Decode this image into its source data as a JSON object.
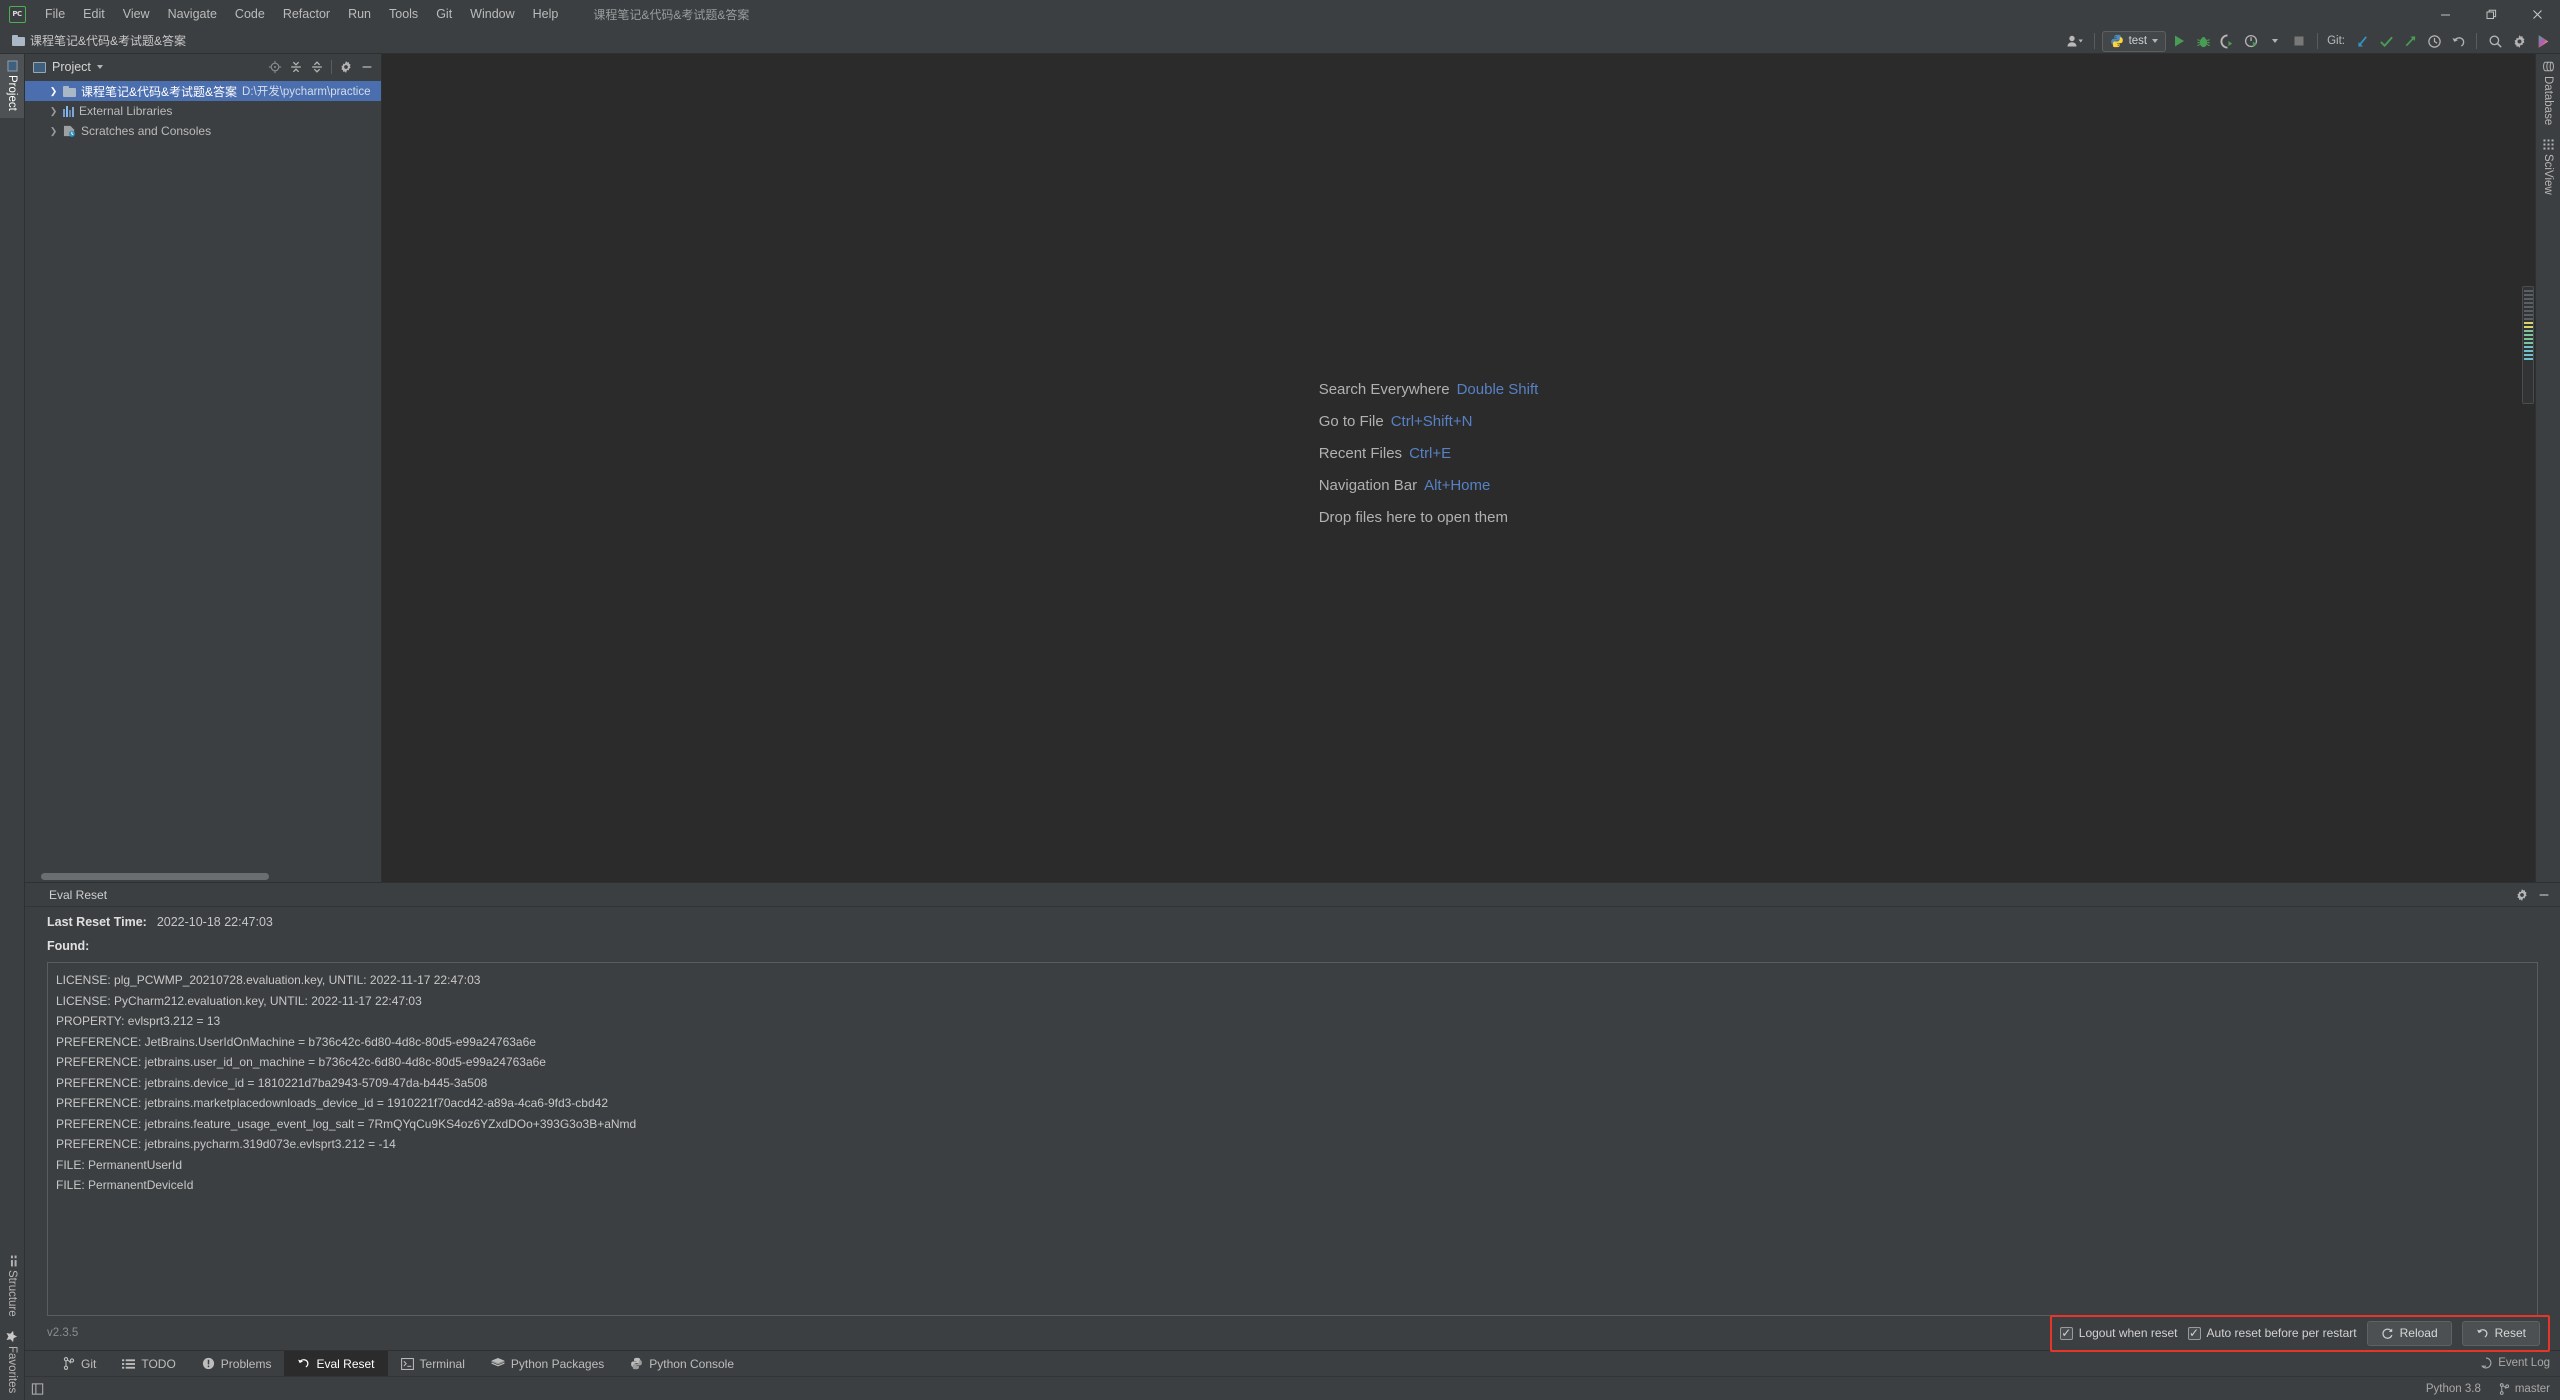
{
  "window": {
    "title": "课程笔记&代码&考试题&答案",
    "controls": {
      "minimize": "minimize-icon",
      "maximize": "maximize-icon",
      "close": "close-icon"
    }
  },
  "menubar": {
    "items": [
      "File",
      "Edit",
      "View",
      "Navigate",
      "Code",
      "Refactor",
      "Run",
      "Tools",
      "Git",
      "Window",
      "Help"
    ]
  },
  "navbar": {
    "breadcrumb": "课程笔记&代码&考试题&答案"
  },
  "toolbar": {
    "run_config": "test",
    "git_label": "Git:",
    "icons": [
      "user-avatar-icon",
      "run-icon",
      "debug-icon",
      "run-coverage-icon",
      "profile-icon",
      "stop-icon",
      "update-project-icon",
      "commit-icon",
      "push-icon",
      "history-icon",
      "rollback-icon",
      "search-everywhere-icon",
      "settings-icon",
      "ide-feature-icon"
    ]
  },
  "left_rail": {
    "top": [
      {
        "label": "Project",
        "active": true,
        "icon": "project-icon"
      }
    ],
    "bottom": [
      {
        "label": "Structure",
        "active": false,
        "icon": "structure-icon"
      },
      {
        "label": "Favorites",
        "active": false,
        "icon": "star-icon"
      }
    ]
  },
  "right_rail": {
    "items": [
      {
        "label": "Database",
        "icon": "database-icon"
      },
      {
        "label": "SciView",
        "icon": "sciview-icon"
      }
    ]
  },
  "project": {
    "title": "Project",
    "tools": [
      "locate-icon",
      "expand-all-icon",
      "collapse-all-icon",
      "gear-icon",
      "hide-icon"
    ],
    "tree": [
      {
        "label": "课程笔记&代码&考试题&答案",
        "path": "D:\\开发\\pycharm\\practice",
        "icon": "folder-icon",
        "selected": true
      },
      {
        "label": "External Libraries",
        "path": "",
        "icon": "library-icon",
        "selected": false
      },
      {
        "label": "Scratches and Consoles",
        "path": "",
        "icon": "scratches-icon",
        "selected": false
      }
    ]
  },
  "editor": {
    "hints": [
      {
        "label": "Search Everywhere",
        "shortcut": "Double Shift"
      },
      {
        "label": "Go to File",
        "shortcut": "Ctrl+Shift+N"
      },
      {
        "label": "Recent Files",
        "shortcut": "Ctrl+E"
      },
      {
        "label": "Navigation Bar",
        "shortcut": "Alt+Home"
      }
    ],
    "drop_hint": "Drop files here to open them"
  },
  "eval_reset": {
    "panel_title": "Eval Reset",
    "panel_tools": [
      "gear-icon",
      "hide-icon"
    ],
    "last_reset_label": "Last Reset Time:",
    "last_reset_value": "2022-10-18 22:47:03",
    "found_label": "Found:",
    "log_lines": [
      "LICENSE: plg_PCWMP_20210728.evaluation.key, UNTIL: 2022-11-17 22:47:03",
      "LICENSE: PyCharm212.evaluation.key, UNTIL: 2022-11-17 22:47:03",
      "PROPERTY: evlsprt3.212 = 13",
      "PREFERENCE: JetBrains.UserIdOnMachine = b736c42c-6d80-4d8c-80d5-e99a24763a6e",
      "PREFERENCE: jetbrains.user_id_on_machine = b736c42c-6d80-4d8c-80d5-e99a24763a6e",
      "PREFERENCE: jetbrains.device_id = 1810221d7ba2943-5709-47da-b445-3a508",
      "PREFERENCE: jetbrains.marketplacedownloads_device_id = 1910221f70acd42-a89a-4ca6-9fd3-cbd42",
      "PREFERENCE: jetbrains.feature_usage_event_log_salt = 7RmQYqCu9KS4oz6YZxdDOo+393G3o3B+aNmd",
      "PREFERENCE: jetbrains.pycharm.319d073e.evlsprt3.212 = -14",
      "FILE: PermanentUserId",
      "FILE: PermanentDeviceId"
    ],
    "version": "v2.3.5",
    "checkbox_logout": "Logout when reset",
    "checkbox_logout_checked": "✓",
    "checkbox_auto": "Auto reset before per restart",
    "checkbox_auto_checked": "✓",
    "reload_button": "Reload",
    "reset_button": "Reset",
    "highlight_color": "#e8352a"
  },
  "bottom_tabs": [
    {
      "label": "Git",
      "icon": "branch-icon",
      "active": false
    },
    {
      "label": "TODO",
      "icon": "todo-icon",
      "active": false
    },
    {
      "label": "Problems",
      "icon": "problems-icon",
      "active": false
    },
    {
      "label": "Eval Reset",
      "icon": "reset-icon",
      "active": true
    },
    {
      "label": "Terminal",
      "icon": "terminal-icon",
      "active": false
    },
    {
      "label": "Python Packages",
      "icon": "packages-icon",
      "active": false
    },
    {
      "label": "Python Console",
      "icon": "python-icon",
      "active": false
    }
  ],
  "status_bar": {
    "event_log": "Event Log",
    "interpreter": "Python 3.8",
    "branch": "master"
  },
  "colors": {
    "accent_blue": "#5781c4",
    "selection_blue": "#4b6eaf",
    "panel_bg": "#3c3f41",
    "editor_bg": "#2b2b2b",
    "green": "#499c54",
    "red_highlight": "#e8352a"
  }
}
